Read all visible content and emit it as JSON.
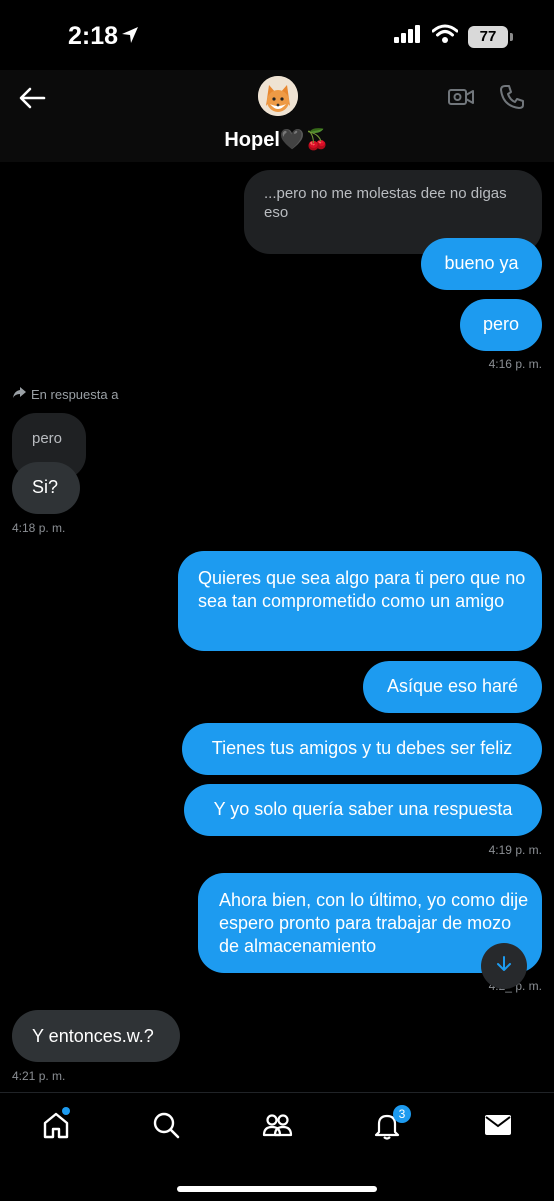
{
  "status": {
    "time": "2:18",
    "battery": "77"
  },
  "header": {
    "name": "Hopel🖤🍒"
  },
  "messages": {
    "quote1": "...pero no me molestas dee no digas eso",
    "m1": "bueno ya",
    "m2": "pero",
    "t1": "4:16 p. m.",
    "reply_label": "En respuesta a",
    "quote2": "pero",
    "m3": "Si?",
    "t2": "4:18 p. m.",
    "m4": "Quieres que sea algo para ti pero que no sea tan comprometido como un amigo",
    "m5": "Asíque eso haré",
    "m6": "Tienes tus amigos y tu debes ser feliz",
    "m7": "Y yo solo quería saber una respuesta",
    "t3": "4:19 p. m.",
    "m8": "Ahora bien, con lo último, yo como dije espero pronto para trabajar de mozo de almacenamiento",
    "t4": "4:2_ p. m.",
    "m9": "Y entonces.w.?",
    "t5": "4:21 p. m."
  },
  "tabbar": {
    "notifications_badge": "3"
  },
  "icons": {
    "back": "arrow-left-icon",
    "video": "video-camera-icon",
    "phone": "phone-icon",
    "home": "home-icon",
    "search": "search-icon",
    "communities": "people-icon",
    "notifications": "bell-icon",
    "messages": "envelope-icon",
    "scroll_down": "arrow-down-icon"
  },
  "colors": {
    "accent": "#1d9bf0",
    "incoming": "#2f3336",
    "background": "#000000"
  }
}
